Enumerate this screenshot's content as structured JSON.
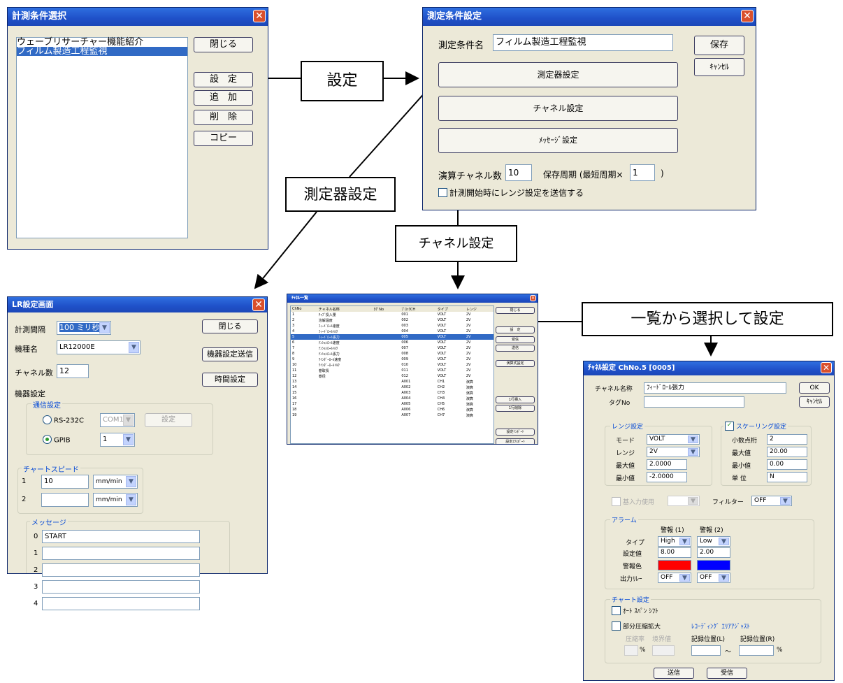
{
  "win1": {
    "title": "計測条件選択",
    "items": [
      "ウェーブリサーチャー機能紹介",
      "フィルム製造工程監視"
    ],
    "buttons": [
      "閉じる",
      "設　定",
      "追　加",
      "削　除",
      "コピー"
    ]
  },
  "win2": {
    "title": "測定条件設定",
    "name_label": "測定条件名",
    "name_value": "フィルム製造工程監視",
    "save": "保存",
    "cancel": "ｷｬﾝｾﾙ",
    "big_buttons": [
      "測定器設定",
      "チャネル設定",
      "ﾒｯｾｰｼﾞ設定"
    ],
    "calc_label": "演算チャネル数",
    "calc_value": "10",
    "period_label": "保存周期 (最短周期×",
    "period_value": "1",
    "period_close": ")",
    "check_label": "計測開始時にレンジ設定を送信する"
  },
  "callouts": {
    "settei": "設定",
    "sokuteiki": "測定器設定",
    "channel": "チャネル設定",
    "ichiran": "一覧から選択して設定"
  },
  "win3": {
    "title": "LR設定画面",
    "interval_label": "計測間隔",
    "interval_value": "100 ミリ秒",
    "model_label": "機種名",
    "model_value": "LR12000E",
    "ch_label": "チャネル数",
    "ch_value": "12",
    "close": "閉じる",
    "send": "機器設定送信",
    "time": "時間設定",
    "device_label": "機器設定",
    "comm_group": "通信設定",
    "rs_label": "RS-232C",
    "com_value": "COM1",
    "com_set": "設定",
    "gpib_label": "GPIB",
    "gpib_value": "1",
    "speed_group": "チャートスピード",
    "speeds": [
      {
        "n": "1",
        "v": "10",
        "u": "mm/min"
      },
      {
        "n": "2",
        "v": "",
        "u": "mm/min"
      }
    ],
    "msg_group": "メッセージ",
    "messages": [
      {
        "n": "0",
        "v": "START"
      },
      {
        "n": "1",
        "v": ""
      },
      {
        "n": "2",
        "v": ""
      },
      {
        "n": "3",
        "v": ""
      },
      {
        "n": "4",
        "v": ""
      }
    ]
  },
  "win4": {
    "title": "ﾁｬﾈﾙ一覧",
    "headers": [
      "ChNo",
      "チャネル名称",
      "ﾀｸﾞNo",
      "ﾌﾞﾛｯｸCH",
      "タイプ",
      "レンジ"
    ],
    "rows": [
      [
        "1",
        "ﾁｬﾌﾟ投入量",
        "",
        "001",
        "VOLT",
        "2V"
      ],
      [
        "2",
        "溶解温度",
        "",
        "002",
        "VOLT",
        "2V"
      ],
      [
        "3",
        "ﾌｨｰﾄﾞﾛｰﾙ速度",
        "",
        "003",
        "VOLT",
        "2V"
      ],
      [
        "4",
        "ﾌｨｰﾄﾞﾛｰﾙﾄﾙｸ",
        "",
        "004",
        "VOLT",
        "2V"
      ],
      [
        "5",
        "ﾌｨｰﾄﾞﾛｰﾙ張力",
        "",
        "005",
        "VOLT",
        "2V"
      ],
      [
        "6",
        "ﾃﾝｼｮﾝﾛｰﾙ速度",
        "",
        "006",
        "VOLT",
        "2V"
      ],
      [
        "7",
        "ﾃﾝｼｮﾝﾛｰﾙﾄﾙｸ",
        "",
        "007",
        "VOLT",
        "2V"
      ],
      [
        "8",
        "ﾃﾝｼｮﾝﾛｰﾙ張力",
        "",
        "008",
        "VOLT",
        "2V"
      ],
      [
        "9",
        "ﾜｲﾝﾀﾞｰﾛｰﾙ速度",
        "",
        "009",
        "VOLT",
        "2V"
      ],
      [
        "10",
        "ﾜｲﾝﾀﾞｰﾛｰﾙﾄﾙｸ",
        "",
        "010",
        "VOLT",
        "2V"
      ],
      [
        "11",
        "巻取長",
        "",
        "011",
        "VOLT",
        "2V"
      ],
      [
        "12",
        "巻径",
        "",
        "012",
        "VOLT",
        "2V"
      ],
      [
        "13",
        "",
        "",
        "A001",
        "CH1",
        "演算"
      ],
      [
        "14",
        "",
        "",
        "A002",
        "CH2",
        "演算"
      ],
      [
        "15",
        "",
        "",
        "A003",
        "CH3",
        "演算"
      ],
      [
        "16",
        "",
        "",
        "A004",
        "CH4",
        "演算"
      ],
      [
        "17",
        "",
        "",
        "A005",
        "CH5",
        "演算"
      ],
      [
        "18",
        "",
        "",
        "A006",
        "CH6",
        "演算"
      ],
      [
        "19",
        "",
        "",
        "A007",
        "CH7",
        "演算"
      ]
    ],
    "buttons": [
      "閉じる",
      "設　定",
      "受信",
      "送信",
      "演算式設定",
      "1行挿入",
      "1行削除",
      "設定ｲﾝﾎﾟｰﾄ",
      "設定ｴｸｽﾎﾟｰﾄ"
    ]
  },
  "win5": {
    "title": "ﾁｬﾈﾙ設定 ChNo.5 [0005]",
    "name_label": "チャネル名称",
    "name_value": "ﾌｨｰﾄﾞﾛｰﾙ張力",
    "tag_label": "タグNo",
    "ok": "OK",
    "cancel": "ｷｬﾝｾﾙ",
    "range_group": "レンジ設定",
    "mode_label": "モード",
    "mode_value": "VOLT",
    "range_label": "レンジ",
    "range_value": "2V",
    "max_label": "最大値",
    "max_value": "2.0000",
    "min_label": "最小値",
    "min_value": "-2.0000",
    "scale_group": "スケーリング設定",
    "dec_label": "小数点桁",
    "dec_value": "2",
    "smax_label": "最大値",
    "smax_value": "20.00",
    "smin_label": "最小値",
    "smin_value": "0.00",
    "unit_label": "単 位",
    "unit_value": "N",
    "ref_label": "基入力使用",
    "filter_label": "フィルター",
    "filter_value": "OFF",
    "alarm_group": "アラーム",
    "alarm1": "警報 (1)",
    "alarm2": "警報 (2)",
    "type_label": "タイプ",
    "type1": "High",
    "type2": "Low",
    "set_label": "設定値",
    "set1": "8.00",
    "set2": "2.00",
    "color_label": "警報色",
    "color1": "#ff0000",
    "color2": "#0000ff",
    "out_label": "出力ﾘﾚｰ",
    "out1": "OFF",
    "out2": "OFF",
    "chart_group": "チャート設定",
    "auto_label": "ｵｰﾄ ｽﾊﾟﾝ ｼﾌﾄ",
    "partial_label": "部分圧縮拡大",
    "rec_label": "ﾚｺｰﾃﾞｨﾝｸﾞ ｴﾘｱｱｼﾞｬｽﾄ",
    "ratio_label": "圧縮率",
    "boundary_label": "境界値",
    "pct": "%",
    "recL": "記録位置(L)",
    "recR": "記録位置(R)",
    "tilde": "～",
    "send": "送信",
    "recv": "受信"
  }
}
